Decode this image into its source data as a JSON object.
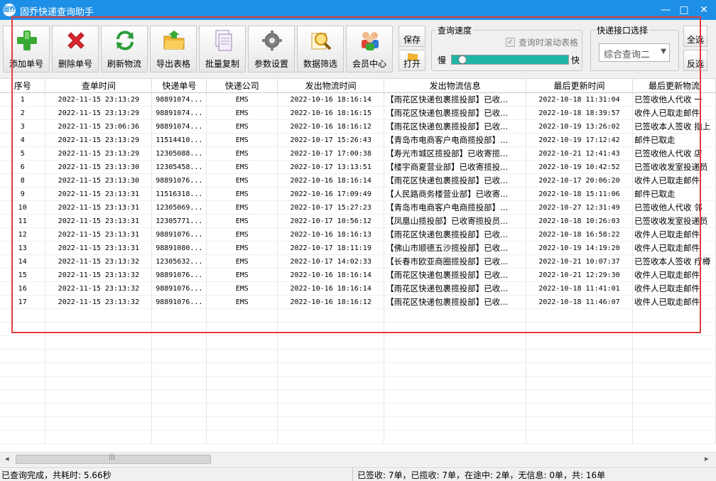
{
  "window": {
    "title": "固乔快递查询助手",
    "icon_text": "固乔",
    "minimize": "—",
    "maximize": "□",
    "close": "✕"
  },
  "toolbar": {
    "buttons": [
      {
        "label": "添加单号",
        "icon": "plus-icon"
      },
      {
        "label": "删除单号",
        "icon": "delete-x-icon"
      },
      {
        "label": "刷新物流",
        "icon": "refresh-icon"
      },
      {
        "label": "导出表格",
        "icon": "export-folder-icon"
      },
      {
        "label": "批量复制",
        "icon": "copy-icon"
      },
      {
        "label": "参数设置",
        "icon": "gear-icon"
      },
      {
        "label": "数据筛选",
        "icon": "magnifier-icon"
      },
      {
        "label": "会员中心",
        "icon": "members-icon"
      }
    ],
    "save_label": "保存",
    "open_label": "打开",
    "speed": {
      "title": "查询速度",
      "scroll_checkbox_label": "查询时滚动表格",
      "scroll_checked": true,
      "slow_label": "慢",
      "fast_label": "快",
      "level": 0.05
    },
    "interface": {
      "title": "快递接口选择",
      "selected": "综合查询二"
    },
    "select_all_label": "全选",
    "invert_label": "反选"
  },
  "colors": {
    "titlebar": "#1e8fe6",
    "highlight_box": "#e23c3c",
    "slider": "#1fb6a8"
  },
  "table": {
    "columns": [
      "序号",
      "查单时间",
      "快递单号",
      "快递公司",
      "发出物流时间",
      "发出物流信息",
      "最后更新时间",
      "最后更新物流"
    ],
    "rows": [
      [
        "1",
        "2022-11-15 23:13:29",
        "98891074...",
        "EMS",
        "2022-10-16 18:16:14",
        "【雨花区快递包裹揽投部】已收...",
        "2022-10-18 11:31:04",
        "已签收他人代收 一"
      ],
      [
        "2",
        "2022-11-15 23:13:29",
        "98891074...",
        "EMS",
        "2022-10-16 18:16:15",
        "【雨花区快递包裹揽投部】已收...",
        "2022-10-18 18:39:57",
        "收件人已取走邮件"
      ],
      [
        "3",
        "2022-11-15 23:06:36",
        "98891074...",
        "EMS",
        "2022-10-16 18:16:12",
        "【雨花区快递包裹揽投部】已收...",
        "2022-10-19 13:26:02",
        "已签收本人签收 指上"
      ],
      [
        "4",
        "2022-11-15 23:13:29",
        "11514410...",
        "EMS",
        "2022-10-17 15:26:43",
        "【青岛市电商客户电商揽投部】...",
        "2022-10-19 17:12:42",
        "邮件已取走"
      ],
      [
        "5",
        "2022-11-15 23:13:29",
        "12305088...",
        "EMS",
        "2022-10-17 17:00:38",
        "【寿光市城区揽投部】已收寄揽...",
        "2022-10-21 12:41:43",
        "已签收他人代收 店"
      ],
      [
        "6",
        "2022-11-15 23:13:30",
        "12305458...",
        "EMS",
        "2022-10-17 13:13:51",
        "【楼宇商夏营业部】已收寄揽投...",
        "2022-10-19 10:42:52",
        "已签收收发室投递员"
      ],
      [
        "8",
        "2022-11-15 23:13:30",
        "98891076...",
        "EMS",
        "2022-10-16 18:16:14",
        "【雨花区快递包裹揽投部】已收...",
        "2022-10-17 20:06:20",
        "收件人已取走邮件"
      ],
      [
        "9",
        "2022-11-15 23:13:31",
        "11516318...",
        "EMS",
        "2022-10-16 17:09:49",
        "【人民路商务楼营业部】已收寄...",
        "2022-10-18 15:11:06",
        "邮件已取走"
      ],
      [
        "10",
        "2022-11-15 23:13:31",
        "12305069...",
        "EMS",
        "2022-10-17 15:27:23",
        "【青岛市电商客户电商揽投部】...",
        "2022-10-27 12:31:49",
        "已签收他人代收 邻"
      ],
      [
        "11",
        "2022-11-15 23:13:31",
        "12305771...",
        "EMS",
        "2022-10-17 10:56:12",
        "【凤凰山揽投部】已收寄揽投员...",
        "2022-10-18 10:26:03",
        "已签收收发室投递员"
      ],
      [
        "12",
        "2022-11-15 23:13:31",
        "98891076...",
        "EMS",
        "2022-10-16 18:16:13",
        "【雨花区快递包裹揽投部】已收...",
        "2022-10-18 16:58:22",
        "收件人已取走邮件"
      ],
      [
        "13",
        "2022-11-15 23:13:31",
        "98891080...",
        "EMS",
        "2022-10-17 18:11:19",
        "【佛山市顺德五沙揽投部】已收...",
        "2022-10-19 14:19:20",
        "收件人已取走邮件"
      ],
      [
        "14",
        "2022-11-15 23:13:32",
        "12305632...",
        "EMS",
        "2022-10-17 14:02:33",
        "【长春市欧亚商圈揽投部】已收...",
        "2022-10-21 10:07:37",
        "已签收本人签收 疗樽"
      ],
      [
        "15",
        "2022-11-15 23:13:32",
        "98891076...",
        "EMS",
        "2022-10-16 18:16:14",
        "【雨花区快递包裹揽投部】已收...",
        "2022-10-21 12:29:30",
        "收件人已取走邮件"
      ],
      [
        "16",
        "2022-11-15 23:13:32",
        "98891076...",
        "EMS",
        "2022-10-16 18:16:14",
        "【雨花区快递包裹揽投部】已收...",
        "2022-10-18 11:41:01",
        "收件人已取走邮件"
      ],
      [
        "17",
        "2022-11-15 23:13:32",
        "98891076...",
        "EMS",
        "2022-10-16 18:16:12",
        "【雨花区快递包裹揽投部】已收...",
        "2022-10-18 11:46:07",
        "收件人已取走邮件"
      ]
    ]
  },
  "scrollbar": {
    "left_arrow": "◂",
    "right_arrow": "▸",
    "grip": "|||"
  },
  "status": {
    "left": "已查询完成，共耗时: 5.66秒",
    "right": "已签收: 7单，已揽收: 7单，在途中: 2单，无信息: 0单，共: 16单"
  }
}
